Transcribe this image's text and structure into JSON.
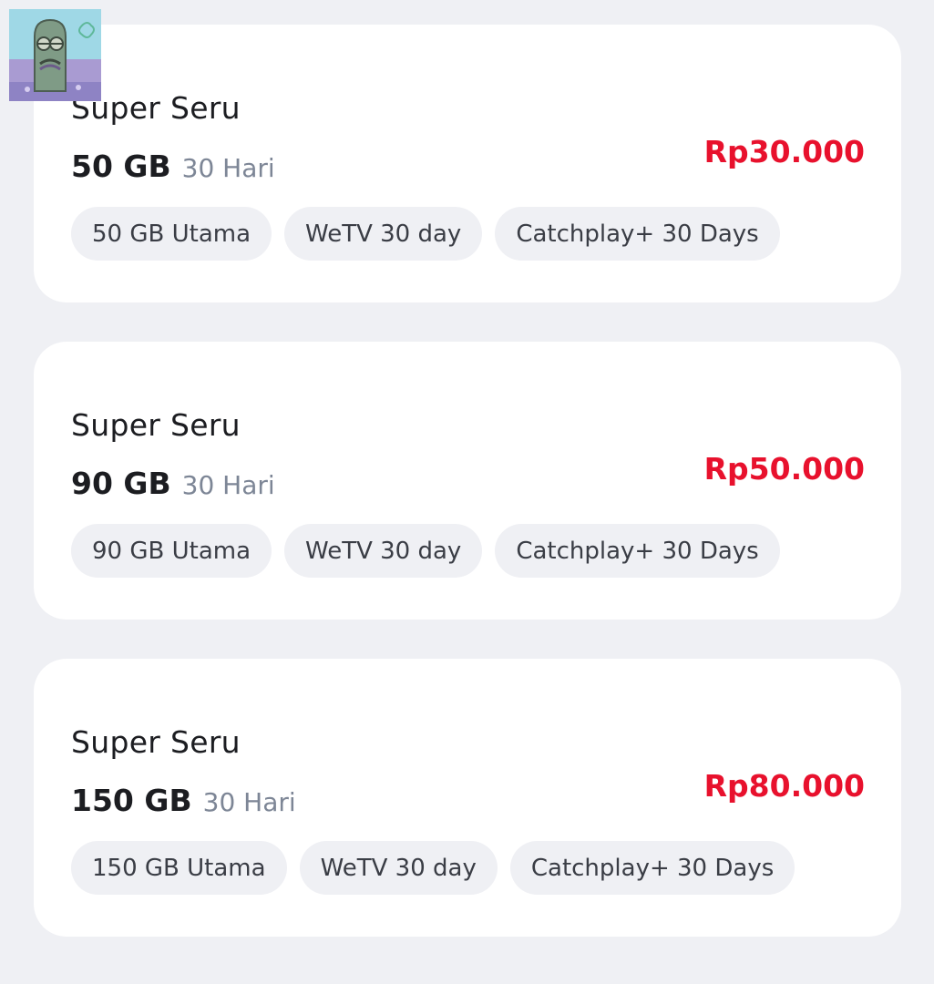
{
  "packages": [
    {
      "title": "Super Seru",
      "quota": "50 GB",
      "duration": "30 Hari",
      "price": "Rp30.000",
      "chips": [
        "50 GB Utama",
        "WeTV 30 day",
        "Catchplay+ 30 Days"
      ]
    },
    {
      "title": "Super Seru",
      "quota": "90 GB",
      "duration": "30 Hari",
      "price": "Rp50.000",
      "chips": [
        "90 GB Utama",
        "WeTV 30 day",
        "Catchplay+ 30 Days"
      ]
    },
    {
      "title": "Super Seru",
      "quota": "150 GB",
      "duration": "30 Hari",
      "price": "Rp80.000",
      "chips": [
        "150 GB Utama",
        "WeTV 30 day",
        "Catchplay+ 30 Days"
      ]
    }
  ],
  "colors": {
    "background": "#eff0f4",
    "card": "#ffffff",
    "price": "#e8112d",
    "muted": "#7d8696",
    "chip_bg": "#eff0f4"
  },
  "avatar": {
    "icon": "avatar-image"
  }
}
